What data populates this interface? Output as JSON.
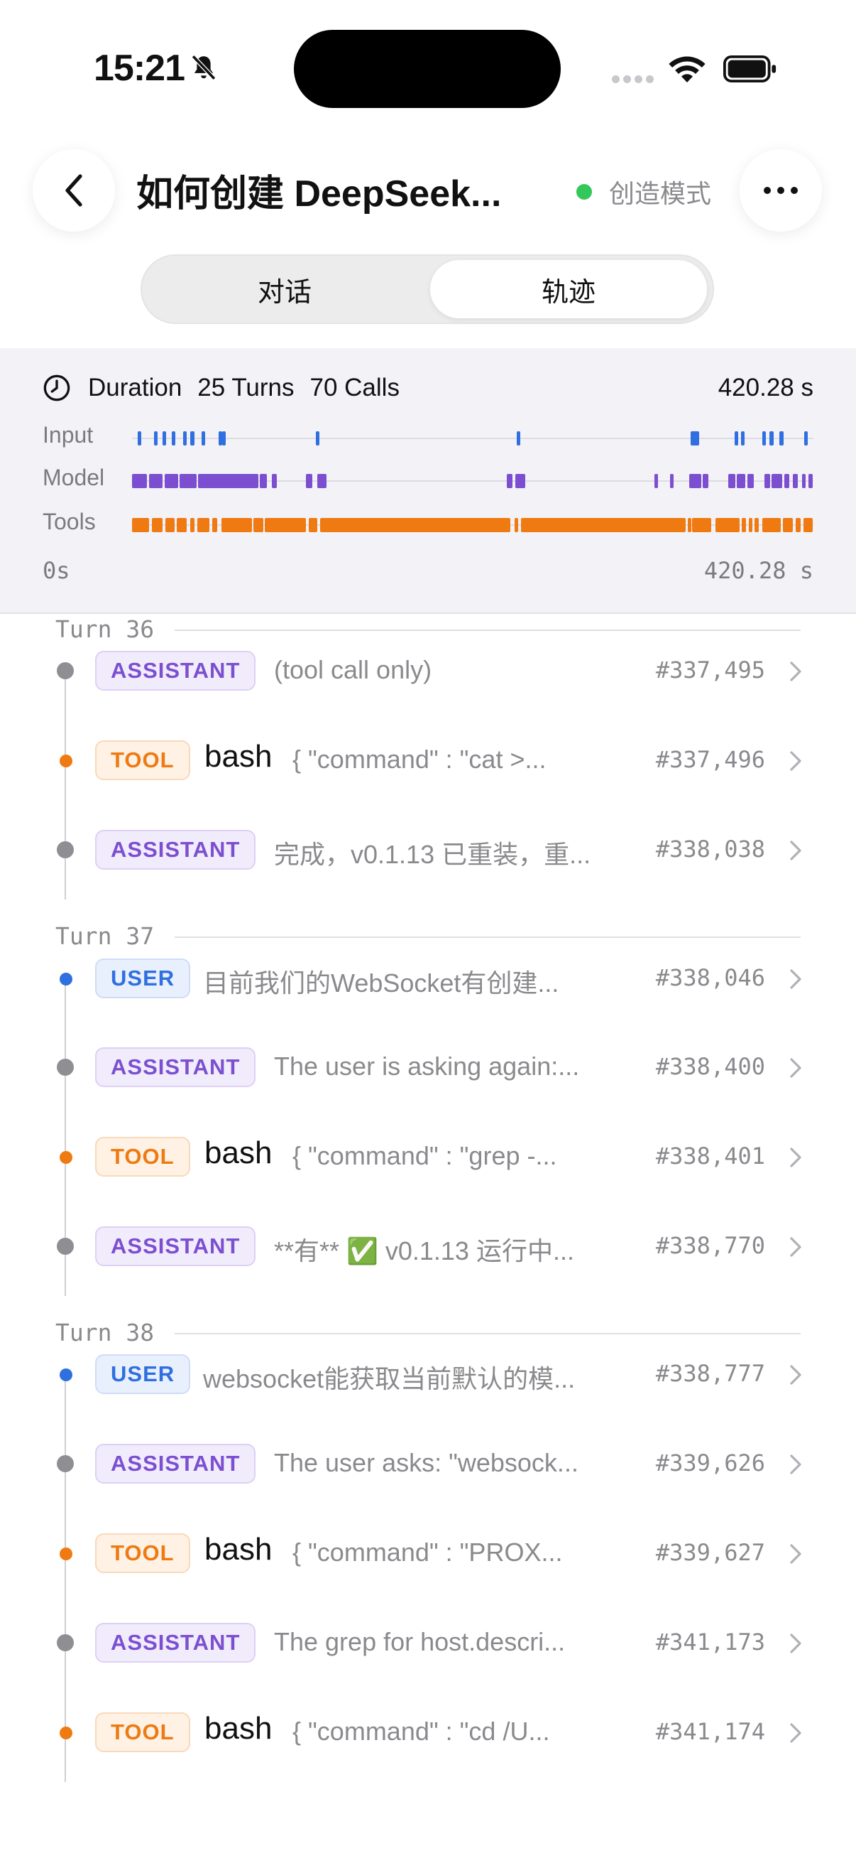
{
  "status_bar": {
    "time": "15:21",
    "icons": [
      "bell-slash-icon",
      "wifi-icon",
      "battery-icon"
    ]
  },
  "header": {
    "title": "如何创建 DeepSeek...",
    "mode_label": "创造模式",
    "mode_color": "#34c759"
  },
  "tabs": [
    {
      "label": "对话",
      "selected": false
    },
    {
      "label": "轨迹",
      "selected": true
    }
  ],
  "summary": {
    "duration_label": "Duration",
    "turns": "25 Turns",
    "calls": "70 Calls",
    "duration": "420.28 s",
    "lanes": [
      {
        "label": "Input",
        "color": "#2f6fe0"
      },
      {
        "label": "Model",
        "color": "#7c4fd0"
      },
      {
        "label": "Tools",
        "color": "#f07a12"
      }
    ],
    "axis_start": "0s",
    "axis_end": "420.28 s"
  },
  "colors": {
    "assistant": "#7c4fd0",
    "tool": "#ee7a12",
    "user": "#2f6fe0",
    "node_assistant": "#8e8e93",
    "node_tool": "#f07a12",
    "node_user": "#2f6fe0"
  },
  "turns": [
    {
      "label": "Turn 36",
      "rows": [
        {
          "role": "ASSISTANT",
          "kind": "assistant",
          "preview": "(tool call only)",
          "id": "#337,495"
        },
        {
          "role": "TOOL",
          "kind": "tool",
          "tool": "bash",
          "args": "{ \"command\" : \"cat >...",
          "id": "#337,496"
        },
        {
          "role": "ASSISTANT",
          "kind": "assistant",
          "preview": "完成，v0.1.13 已重装，重...",
          "id": "#338,038"
        }
      ]
    },
    {
      "label": "Turn 37",
      "rows": [
        {
          "role": "USER",
          "kind": "user",
          "preview": "目前我们的WebSocket有创建...",
          "id": "#338,046"
        },
        {
          "role": "ASSISTANT",
          "kind": "assistant",
          "preview": "The user is asking again:...",
          "id": "#338,400"
        },
        {
          "role": "TOOL",
          "kind": "tool",
          "tool": "bash",
          "args": "{ \"command\" : \"grep -...",
          "id": "#338,401"
        },
        {
          "role": "ASSISTANT",
          "kind": "assistant",
          "preview": "**有** ✅ v0.1.13 运行中...",
          "id": "#338,770"
        }
      ]
    },
    {
      "label": "Turn 38",
      "rows": [
        {
          "role": "USER",
          "kind": "user",
          "preview": "websocket能获取当前默认的模...",
          "id": "#338,777"
        },
        {
          "role": "ASSISTANT",
          "kind": "assistant",
          "preview": "The user asks: \"websock...",
          "id": "#339,626"
        },
        {
          "role": "TOOL",
          "kind": "tool",
          "tool": "bash",
          "args": "{ \"command\" : \"PROX...",
          "id": "#339,627"
        },
        {
          "role": "ASSISTANT",
          "kind": "assistant",
          "preview": "The grep for host.descri...",
          "id": "#341,173"
        },
        {
          "role": "TOOL",
          "kind": "tool",
          "tool": "bash",
          "args": "{ \"command\" : \"cd /U...",
          "id": "#341,174"
        }
      ]
    }
  ]
}
